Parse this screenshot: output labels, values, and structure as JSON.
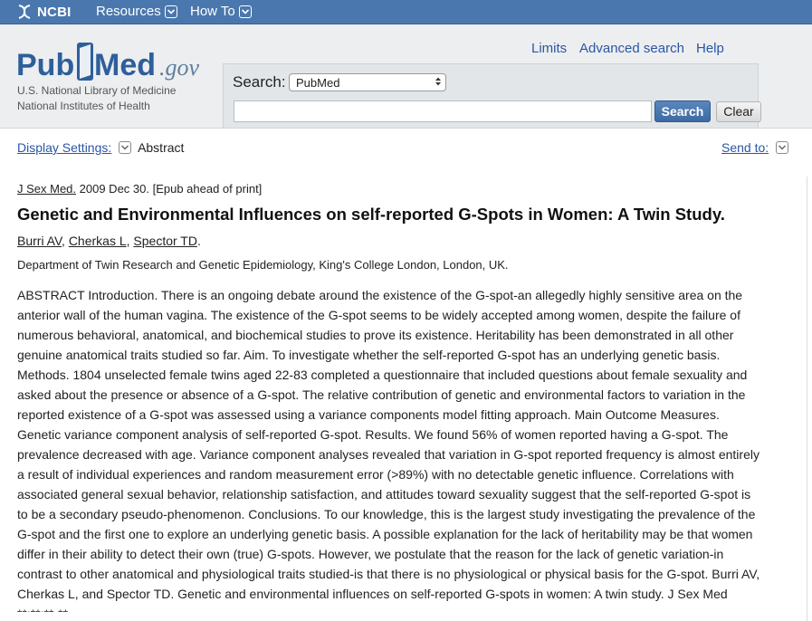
{
  "ncbi_bar": {
    "logo_text": "NCBI",
    "menu": [
      {
        "label": "Resources"
      },
      {
        "label": "How To"
      }
    ]
  },
  "header": {
    "logo": {
      "pub": "Pub",
      "med": "Med",
      "gov": ".gov"
    },
    "org_line1": "U.S. National Library of Medicine",
    "org_line2": "National Institutes of Health",
    "search": {
      "label": "Search:",
      "database": "PubMed",
      "query": "",
      "search_button": "Search",
      "clear_button": "Clear"
    },
    "links": {
      "limits": "Limits",
      "advanced": "Advanced search",
      "help": "Help"
    }
  },
  "display": {
    "settings_label": "Display Settings:",
    "format": "Abstract",
    "send_to": "Send to:"
  },
  "article": {
    "journal": "J Sex Med.",
    "pub_info": " 2009 Dec 30. [Epub ahead of print]",
    "title": "Genetic and Environmental Influences on self-reported G-Spots in Women: A Twin Study.",
    "authors": [
      "Burri AV",
      "Cherkas L",
      "Spector TD"
    ],
    "affiliation": "Department of Twin Research and Genetic Epidemiology, King's College London, London, UK.",
    "abstract_lines": [
      "ABSTRACT Introduction. There is an ongoing debate around the existence of the G-spot-an allegedly highly sensitive area on the",
      "anterior wall of the human vagina. The existence of the G-spot seems to be widely accepted among women, despite the failure of",
      "numerous behavioral, anatomical, and biochemical studies to prove its existence. Heritability has been demonstrated in all other",
      "genuine anatomical traits studied so far. Aim. To investigate whether the self-reported G-spot has an underlying genetic basis.",
      "Methods. 1804 unselected female twins aged 22-83 completed a questionnaire that included questions about female sexuality and",
      "asked about the presence or absence of a G-spot. The relative contribution of genetic and environmental factors to variation in the",
      "reported existence of a G-spot was assessed using a variance components model fitting approach. Main Outcome Measures.",
      "Genetic variance component analysis of self-reported G-spot. Results. We found 56% of women reported having a G-spot. The",
      "prevalence decreased with age. Variance component analyses revealed that variation in G-spot reported frequency is almost entirely",
      "a result of individual experiences and random measurement error (>89%) with no detectable genetic influence. Correlations with",
      "associated general sexual behavior, relationship satisfaction, and attitudes toward sexuality suggest that the self-reported G-spot is",
      "to be a secondary pseudo-phenomenon. Conclusions. To our knowledge, this is the largest study investigating the prevalence of the",
      "G-spot and the first one to explore an underlying genetic basis. A possible explanation for the lack of heritability may be that women",
      "differ in their ability to detect their own (true) G-spots. However, we postulate that the reason for the lack of genetic variation-in",
      "contrast to other anatomical and physiological traits studied-is that there is no physiological or physical basis for the G-spot. Burri AV,",
      "Cherkas L, and Spector TD. Genetic and environmental influences on self-reported G-spots in women: A twin study. J Sex Med"
    ],
    "abstract_cut_line": "**;**;**-**."
  },
  "colors": {
    "ncbi_bar": "#4a78ae",
    "header_bg": "#eceeef",
    "link": "#2a56a5",
    "pub_text": "#2e5f9b",
    "med_box": "#2e5f9b"
  },
  "icons": [
    "ncbi-helix-icon",
    "chevron-down-icon",
    "select-updown-icon"
  ]
}
